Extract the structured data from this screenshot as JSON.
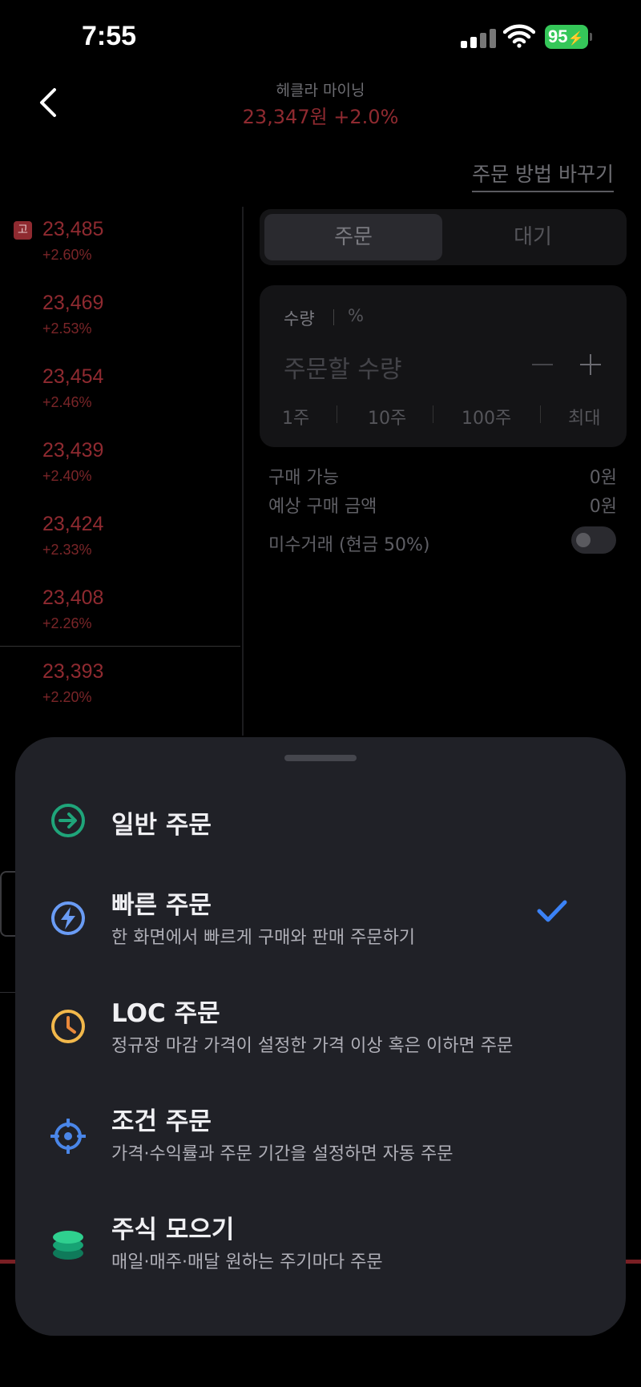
{
  "status_bar": {
    "time": "7:55",
    "battery": "95"
  },
  "header": {
    "stock_name": "헤클라 마이닝",
    "price_line": "23,347원 +2.0%",
    "change_method": "주문 방법 바꾸기"
  },
  "order_book": {
    "high_badge": "고",
    "rows": [
      {
        "price": "23,485",
        "change": "+2.60%"
      },
      {
        "price": "23,469",
        "change": "+2.53%"
      },
      {
        "price": "23,454",
        "change": "+2.46%"
      },
      {
        "price": "23,439",
        "change": "+2.40%"
      },
      {
        "price": "23,424",
        "change": "+2.33%"
      },
      {
        "price": "23,408",
        "change": "+2.26%"
      },
      {
        "price": "23,393",
        "change": "+2.20%"
      }
    ]
  },
  "order_panel": {
    "tabs": [
      "주문",
      "대기"
    ],
    "qty_label": "수량",
    "pct_label": "%",
    "qty_placeholder": "주문할 수량",
    "quick_qty": [
      "1주",
      "10주",
      "100주",
      "최대"
    ],
    "available_label": "구매 가능",
    "available_value": "0원",
    "expected_label": "예상 구매 금액",
    "expected_value": "0원",
    "margin_label": "미수거래 (현금 50%)"
  },
  "sheet": {
    "options": [
      {
        "title": "일반 주문",
        "subtitle": "",
        "icon": "arrow-right-circle-icon"
      },
      {
        "title": "빠른 주문",
        "subtitle": "한 화면에서 빠르게 구매와 판매 주문하기",
        "icon": "lightning-icon",
        "selected": true
      },
      {
        "title": "LOC 주문",
        "subtitle": "정규장 마감 가격이 설정한 가격 이상 혹은 이하면 주문",
        "icon": "clock-icon"
      },
      {
        "title": "조건 주문",
        "subtitle": "가격·수익률과 주문 기간을 설정하면 자동 주문",
        "icon": "target-icon"
      },
      {
        "title": "주식 모으기",
        "subtitle": "매일·매주·매달 원하는 주기마다 주문",
        "icon": "coin-stack-icon"
      }
    ]
  },
  "colors": {
    "accent_check": "#3b82f6",
    "price_red": "#8f2a30",
    "battery_green": "#35c759",
    "sheet_bg": "#202127"
  }
}
